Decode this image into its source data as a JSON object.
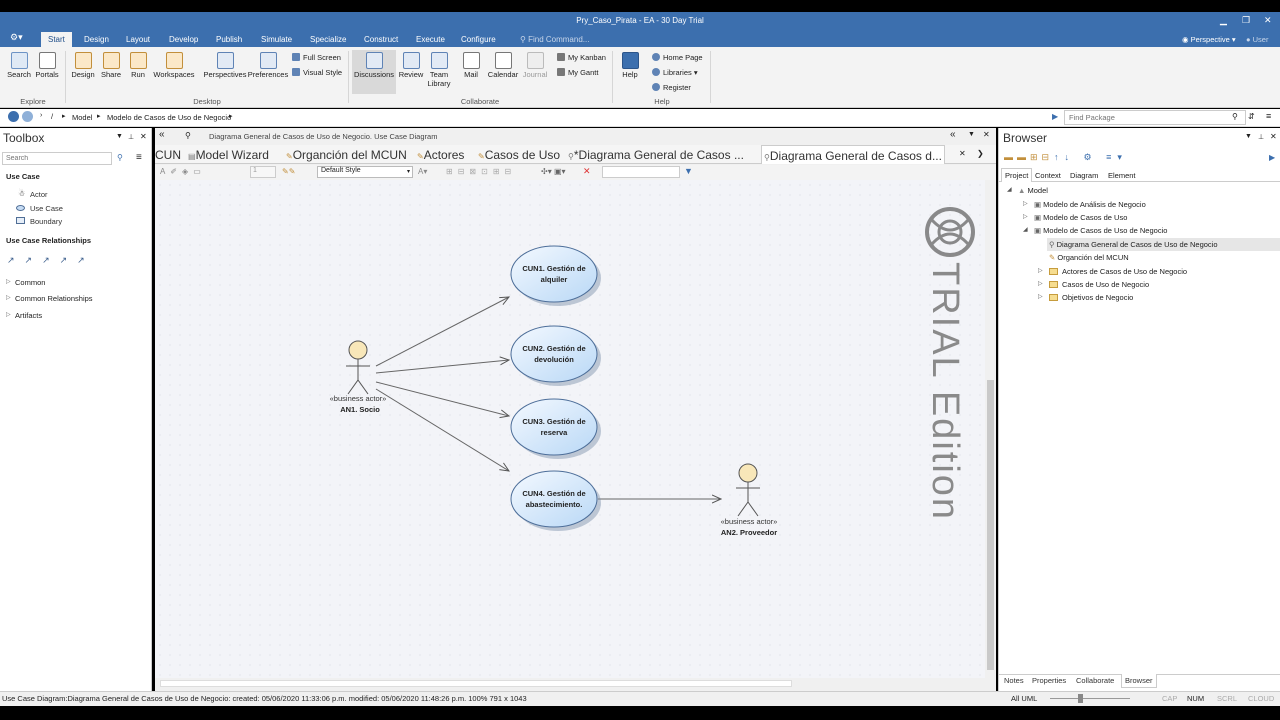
{
  "window": {
    "title": "Pry_Caso_Pirata - EA - 30 Day Trial"
  },
  "menu": {
    "tabs": [
      "Start",
      "Design",
      "Layout",
      "Develop",
      "Publish",
      "Simulate",
      "Specialize",
      "Construct",
      "Execute",
      "Configure"
    ],
    "find": "Find Command...",
    "perspective": "Perspective",
    "user": "User"
  },
  "ribbon": {
    "explore": {
      "label": "Explore",
      "search": "Search",
      "portals": "Portals"
    },
    "desktop": {
      "label": "Desktop",
      "design": "Design",
      "share": "Share",
      "run": "Run",
      "workspaces": "Workspaces",
      "perspectives": "Perspectives",
      "preferences": "Preferences",
      "full_screen": "Full Screen",
      "visual_style": "Visual Style"
    },
    "collaborate": {
      "label": "Collaborate",
      "discussions": "Discussions",
      "review": "Review",
      "team": "Team",
      "library": "Library",
      "mail": "Mail",
      "calendar": "Calendar",
      "journal": "Journal",
      "my_kanban": "My Kanban",
      "my_gantt": "My Gantt"
    },
    "help": {
      "label": "Help",
      "help": "Help",
      "home_page": "Home Page",
      "libraries": "Libraries",
      "register": "Register"
    }
  },
  "breadcrumb": {
    "root": "/",
    "items": [
      "Model",
      "Modelo de Casos de Uso de Negocio"
    ],
    "find_placeholder": "Find Package"
  },
  "toolbox": {
    "title": "Toolbox",
    "search_placeholder": "Search",
    "section1": "Use Case",
    "items": [
      "Actor",
      "Use Case",
      "Boundary"
    ],
    "section2": "Use Case Relationships",
    "collapsed": [
      "Common",
      "Common Relationships",
      "Artifacts"
    ]
  },
  "document": {
    "caption": "Diagrama General de Casos de Uso de Negocio.  Use Case Diagram",
    "tabs": [
      "CUN",
      "Model Wizard",
      "Organción del MCUN",
      "Actores",
      "Casos de Uso",
      "*Diagrama General de Casos ...",
      "Diagrama General de Casos d..."
    ],
    "style": "Default Style",
    "zoom_value": "1"
  },
  "diagram": {
    "watermark": "TRIAL Edition",
    "actors": [
      {
        "stereo": "«business actor»",
        "name": "AN1. Socio"
      },
      {
        "stereo": "«business actor»",
        "name": "AN2. Proveedor"
      }
    ],
    "usecases": [
      {
        "line1": "CUN1. Gestión de",
        "line2": "alquiler"
      },
      {
        "line1": "CUN2. Gestión de",
        "line2": "devolución"
      },
      {
        "line1": "CUN3. Gestión de",
        "line2": "reserva"
      },
      {
        "line1": "CUN4. Gestión de",
        "line2": "abastecimiento."
      }
    ]
  },
  "browser": {
    "title": "Browser",
    "tabs": [
      "Project",
      "Context",
      "Diagram",
      "Element"
    ],
    "tree": [
      "Model",
      "Modelo de Análisis de Negocio",
      "Modelo de Casos de Uso",
      "Modelo de Casos de Uso de Negocio",
      "Diagrama General de Casos de Uso de Negocio",
      "Organción del MCUN",
      "Actores de Casos de Uso de Negocio",
      "Casos de Uso de Negocio",
      "Objetivos de Negocio"
    ],
    "bottom_tabs": [
      "Notes",
      "Properties",
      "Collaborate",
      "Browser"
    ]
  },
  "status": {
    "text": "Use Case Diagram:Diagrama General de Casos de Uso de Negocio:   created: 05/06/2020 11:33:06 p.m.  modified: 05/06/2020 11:48:26 p.m.   100%   791 x 1043",
    "mode": "All UML",
    "caps": "CAP",
    "num": "NUM",
    "scrl": "SCRL",
    "cloud": "CLOUD"
  },
  "colors": {
    "accent": "#3c6fae",
    "usecase_fill": "#d6e9fb",
    "actor_head": "#f8e7b9"
  }
}
